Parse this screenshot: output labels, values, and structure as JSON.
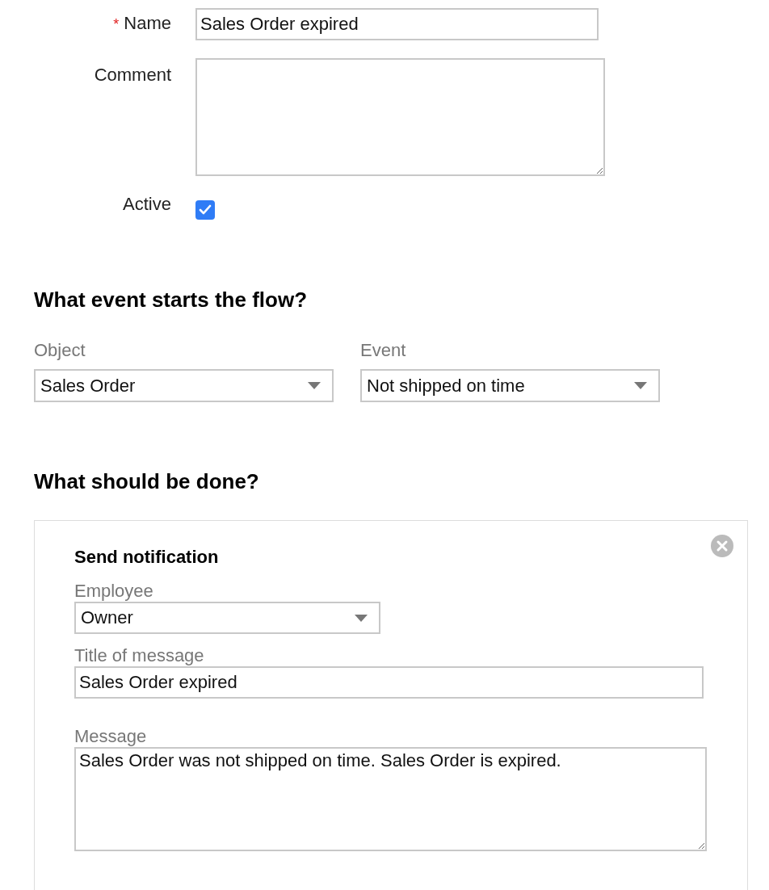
{
  "form": {
    "fields": [
      {
        "kind": "text",
        "label": "Name",
        "required_mark": "*",
        "value": "Sales Order expired"
      },
      {
        "kind": "textarea",
        "label": "Comment"
      },
      {
        "kind": "checkbox",
        "label": "Active",
        "checked": true
      }
    ]
  },
  "trigger": {
    "heading": "What event starts the flow?",
    "selects": [
      {
        "label": "Object",
        "value": "Sales Order"
      },
      {
        "label": "Event",
        "value": "Not shipped on time"
      }
    ]
  },
  "actions": {
    "heading": "What should be done?",
    "cards": [
      {
        "title": "Send notification",
        "fields": [
          {
            "kind": "select",
            "label": "Employee",
            "value": "Owner"
          },
          {
            "kind": "text",
            "label": "Title of message",
            "value": "Sales Order expired"
          },
          {
            "kind": "textarea",
            "label": "Message",
            "value": "Sales Order was not shipped on time. Sales Order is expired."
          }
        ]
      }
    ]
  }
}
